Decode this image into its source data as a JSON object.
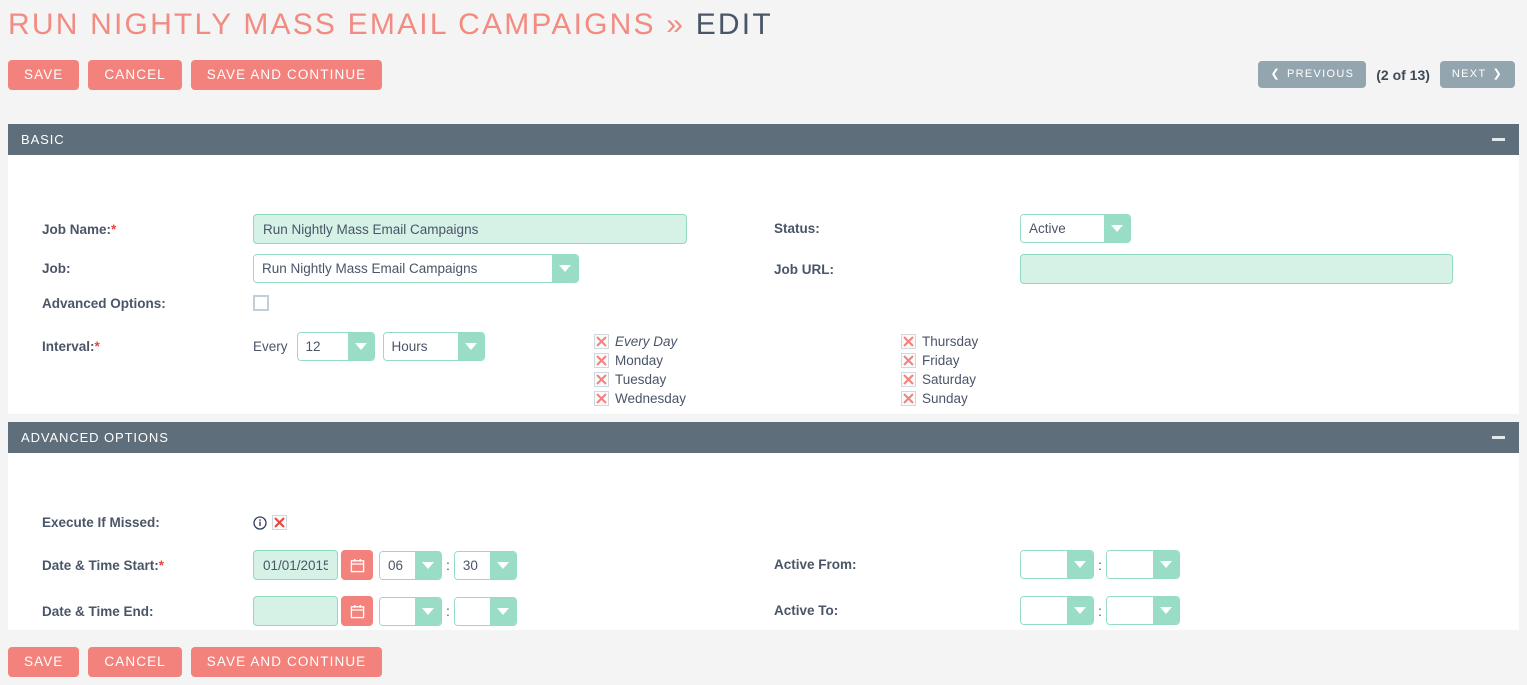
{
  "page": {
    "title_main": "RUN NIGHTLY MASS EMAIL CAMPAIGNS",
    "title_separator": "»",
    "title_sub": "EDIT"
  },
  "toolbar": {
    "save_label": "SAVE",
    "cancel_label": "CANCEL",
    "save_continue_label": "SAVE AND CONTINUE"
  },
  "pager": {
    "previous_label": "PREVIOUS",
    "next_label": "NEXT",
    "count_label": "(2 of 13)",
    "prev_icon": "chevron-left-icon",
    "next_icon": "chevron-right-icon"
  },
  "basic": {
    "header": "BASIC",
    "collapse_icon": "minus-icon",
    "job_name_label": "Job Name:",
    "job_name_required": "*",
    "job_name_value": "Run Nightly Mass Email Campaigns",
    "job_label": "Job:",
    "job_value": "Run Nightly Mass Email Campaigns",
    "advanced_options_label": "Advanced Options:",
    "advanced_options_checked": false,
    "interval_label": "Interval:",
    "interval_required": "*",
    "every_label": "Every",
    "interval_number": "12",
    "interval_unit": "Hours",
    "status_label": "Status:",
    "status_value": "Active",
    "job_url_label": "Job URL:",
    "job_url_value": "",
    "job_url_placeholder": "",
    "days_left": [
      {
        "label": "Every Day",
        "checked": true,
        "emphasis": true
      },
      {
        "label": "Monday",
        "checked": true,
        "emphasis": false
      },
      {
        "label": "Tuesday",
        "checked": true,
        "emphasis": false
      },
      {
        "label": "Wednesday",
        "checked": true,
        "emphasis": false
      }
    ],
    "days_right": [
      {
        "label": "Thursday",
        "checked": true,
        "emphasis": false
      },
      {
        "label": "Friday",
        "checked": true,
        "emphasis": false
      },
      {
        "label": "Saturday",
        "checked": true,
        "emphasis": false
      },
      {
        "label": "Sunday",
        "checked": true,
        "emphasis": false
      }
    ]
  },
  "advanced": {
    "header": "ADVANCED OPTIONS",
    "collapse_icon": "minus-icon",
    "execute_if_missed_label": "Execute If Missed:",
    "execute_if_missed_info_icon": "info-circle-icon",
    "execute_if_missed_checked": true,
    "date_start_label": "Date & Time Start:",
    "date_start_required": "*",
    "date_start_value": "01/01/2015",
    "date_start_hour": "06",
    "date_start_minute": "30",
    "date_end_label": "Date & Time End:",
    "date_end_value": "",
    "date_end_hour": "",
    "date_end_minute": "",
    "calendar_icon": "calendar-icon",
    "time_separator": ":",
    "active_from_label": "Active From:",
    "active_from_hour": "",
    "active_from_minute": "",
    "active_to_label": "Active To:",
    "active_to_hour": "",
    "active_to_minute": ""
  },
  "footer": {
    "save_label": "SAVE",
    "cancel_label": "CANCEL",
    "save_continue_label": "SAVE AND CONTINUE"
  },
  "colors": {
    "accent_salmon": "#f4827c",
    "panel_header": "#5e6e7a",
    "field_mint": "#d6f2e6",
    "field_border": "#8fd9bf",
    "text_slate": "#4a5568",
    "pager_gray": "#93a5ae",
    "required_red": "#e8453c",
    "page_bg": "#f4f4f4"
  }
}
